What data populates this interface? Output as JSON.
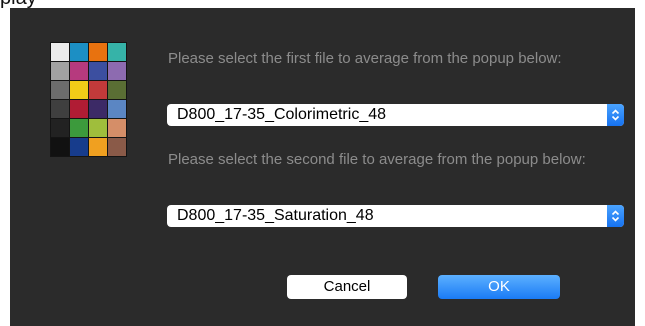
{
  "top_clipped_text": "play",
  "color_checker": {
    "icon": "color-checker-icon",
    "patches": [
      "#ececec",
      "#1c8fc4",
      "#e8720f",
      "#36b3a8",
      "#a2a2a2",
      "#b63a7e",
      "#3c4fa0",
      "#8d6bb0",
      "#6c6c6c",
      "#f1cc18",
      "#c23a3a",
      "#5a6e34",
      "#3f3f3f",
      "#b01c34",
      "#3c2a66",
      "#5b86c3",
      "#222222",
      "#3c9a3c",
      "#9fbe3c",
      "#d58e68",
      "#111111",
      "#173c8c",
      "#f0a020",
      "#8a5a48"
    ]
  },
  "first_file": {
    "prompt": "Please select the first file to average from the popup below:",
    "selected": "D800_17-35_Colorimetric_48"
  },
  "second_file": {
    "prompt": "Please select the second file to average from the popup below:",
    "selected": "D800_17-35_Saturation_48"
  },
  "buttons": {
    "cancel": "Cancel",
    "ok": "OK"
  },
  "colors": {
    "dialog_background": "#2b2b2b",
    "prompt_text": "#8c8c8c",
    "accent_blue": "#1a7bf5"
  }
}
